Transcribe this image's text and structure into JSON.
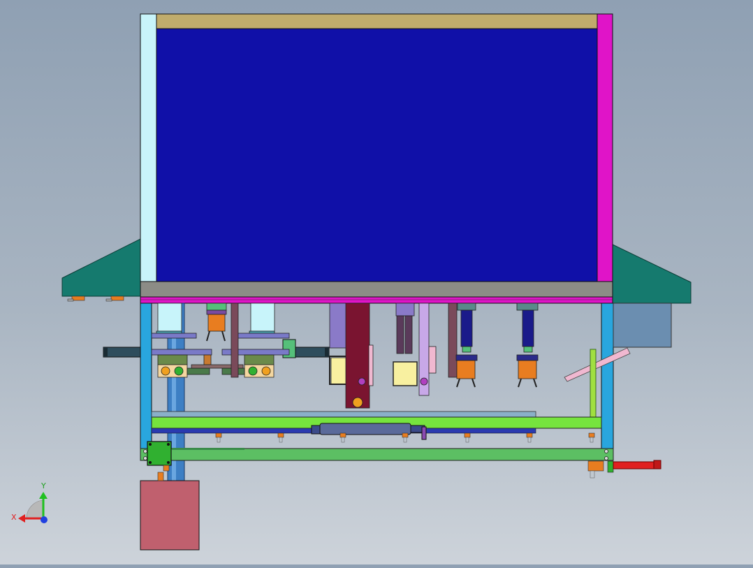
{
  "view": {
    "axes": {
      "y_label": "Y",
      "x_label": "X"
    }
  },
  "colors": {
    "panel_blue": "#1010a8",
    "frame_magenta": "#e014c8",
    "frame_cyan": "#c8f4fa",
    "khaki": "#c0ac6c",
    "teal_hood": "#157a6e",
    "green_rail": "#76e43e",
    "dark_green_rail": "#5cbf63",
    "pink_block": "#c0606e",
    "orange": "#e87d20",
    "maroon": "#7a1430"
  }
}
